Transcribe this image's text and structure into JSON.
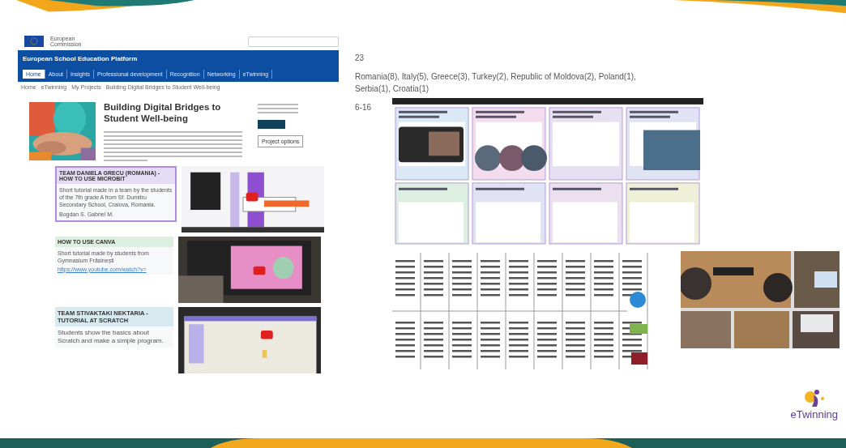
{
  "portal": {
    "brand": "European Commission",
    "platform_title": "European School Education Platform",
    "nav": [
      {
        "label": "Home",
        "selected": true
      },
      {
        "label": "About",
        "selected": false
      },
      {
        "label": "Insights",
        "selected": false
      },
      {
        "label": "Professional development",
        "selected": false
      },
      {
        "label": "Recognition",
        "selected": false
      },
      {
        "label": "Networking",
        "selected": false
      },
      {
        "label": "eTwinning",
        "selected": false
      }
    ],
    "breadcrumb": [
      "Home",
      "eTwinning",
      "My Projects",
      "Building Digital Bridges to Student Well-being"
    ],
    "project": {
      "title": "Building Digital Bridges to Student Well-being",
      "options_button": "Project options"
    }
  },
  "cards": [
    {
      "title": "TEAM DANIELA GRECU (ROMANIA) - HOW TO USE MICROBIT",
      "text": "Short tutorial made in a team by the students of the 7th grade A from Sf. Dumitru Secondary School, Craiova, Romania.",
      "author": "Bogdan S. Gabriel M.",
      "color": "#e4dcf4"
    },
    {
      "title": "HOW TO USE CANVA",
      "text": "Short tutorial made by students from Gymnasium Frăsinești",
      "link": "https://www.youtube.com/watch?v=",
      "color": "#dcefe0"
    },
    {
      "title": "TEAM STIVAKTAKI NEKTARIA - TUTORIAL AT SCRATCH",
      "text": "Students show the basics about Scratch and make a simple program.",
      "color": "#d8e9f0"
    }
  ],
  "facts": {
    "count": "23",
    "countries": "Romania(8), Italy(5), Greece(3), Turkey(2), Republic of Moldova(2), Poland(1), Serbia(1), Croatia(1)",
    "ages": "6-16"
  },
  "logo": "eTwinning"
}
